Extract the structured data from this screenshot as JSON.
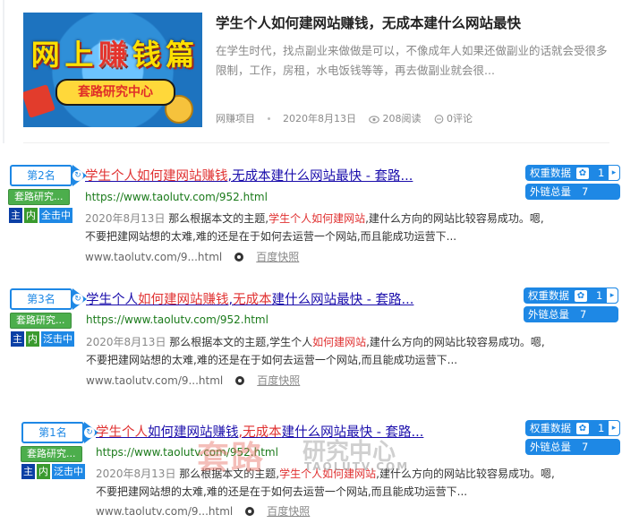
{
  "article": {
    "title": "学生个人如何建网站赚钱，无成本建什么网站最快",
    "excerpt": "在学生时代，找点副业来做做是可以，不像成年人如果还做副业的话就会受很多限制，工作，房租，水电饭钱等等，再去做副业就会很...",
    "category": "网赚项目",
    "date": "2020年8月13日",
    "views": "208阅读",
    "comments": "0评论",
    "thumb": {
      "big_chars": [
        "网",
        "上",
        "赚",
        "钱",
        "篇"
      ],
      "ribbon": "套路研究中心"
    }
  },
  "results": [
    {
      "rank": "第2名",
      "site_badge": "套路研究...",
      "tags": [
        "主",
        "内",
        "全击中"
      ],
      "title_parts": [
        {
          "t": "学生个人如何建网站赚钱",
          "hl": true
        },
        {
          "t": ",无成本建什么网站最快 - 套路...",
          "hl": false
        }
      ],
      "url": "https://www.taolutv.com/952.html",
      "date": "2020年8月13日",
      "desc_parts": [
        {
          "t": " 那么根据本文的主题,",
          "hl": false
        },
        {
          "t": "学生个人如何建网站",
          "hl": true
        },
        {
          "t": ",建什么方向的网站比较容易成功。嗯,不要把建网站想的太难,难的还是在于如何去运营一个网站,而且能成功运营下...",
          "hl": false
        }
      ],
      "display_url": "www.taolutv.com/9...html",
      "snapshot": "百度快照",
      "weight_label": "权重数据",
      "weight_value": "1",
      "links_label": "外链总量",
      "links_value": "7"
    },
    {
      "rank": "第3名",
      "site_badge": "套路研究...",
      "tags": [
        "主",
        "内",
        "泛击中"
      ],
      "title_parts": [
        {
          "t": "学生个人",
          "hl": false
        },
        {
          "t": "如何建网站赚钱",
          "hl": true
        },
        {
          "t": ",",
          "hl": false
        },
        {
          "t": "无成本",
          "hl": true
        },
        {
          "t": "建什么网站最快 - 套路...",
          "hl": false
        }
      ],
      "url": "https://www.taolutv.com/952.html",
      "date": "2020年8月13日",
      "desc_parts": [
        {
          "t": " 那么根据本文的主题,学生个人",
          "hl": false
        },
        {
          "t": "如何建网站",
          "hl": true
        },
        {
          "t": ",建什么方向的网站比较容易成功。嗯,不要把建网站想的太难,难的还是在于如何去运营一个网站,而且能成功运营下...",
          "hl": false
        }
      ],
      "display_url": "www.taolutv.com/9...html",
      "snapshot": "百度快照",
      "weight_label": "权重数据",
      "weight_value": "1",
      "links_label": "外链总量",
      "links_value": "7"
    },
    {
      "rank": "第1名",
      "site_badge": "套路研究...",
      "tags": [
        "主",
        "内",
        "泛击中"
      ],
      "title_parts": [
        {
          "t": "学生个人",
          "hl": true
        },
        {
          "t": "如何建网站赚钱",
          "hl": false
        },
        {
          "t": ",无成本",
          "hl": true
        },
        {
          "t": "建什么网站最快 - 套路...",
          "hl": false
        }
      ],
      "url": "https://www.taolutv.com/952.html",
      "date": "2020年8月13日",
      "desc_parts": [
        {
          "t": " 那么根据本文的主题,",
          "hl": false
        },
        {
          "t": "学生个人",
          "hl": true
        },
        {
          "t": "如何建网站",
          "hl": true
        },
        {
          "t": ",建什么方向的网站比较容易成功。嗯,不要把建网站想的太难,难的还是在于如何去运营一个网站,而且能成功运营下...",
          "hl": false
        }
      ],
      "display_url": "www.taolutv.com/9...html",
      "snapshot": "百度快照",
      "weight_label": "权重数据",
      "weight_value": "1",
      "links_label": "外链总量",
      "links_value": "7"
    }
  ],
  "watermark": {
    "big": "套路",
    "cn": "研究中心",
    "en": "TAOLUTV.COM"
  },
  "colors": {
    "accent": "#1e88e5",
    "highlight": "#e03131",
    "link": "#1a0dab",
    "url": "#1a7a1a"
  },
  "icons": [
    "eye-icon",
    "comment-icon",
    "camera-icon",
    "paw-icon",
    "chevron-right-icon"
  ]
}
